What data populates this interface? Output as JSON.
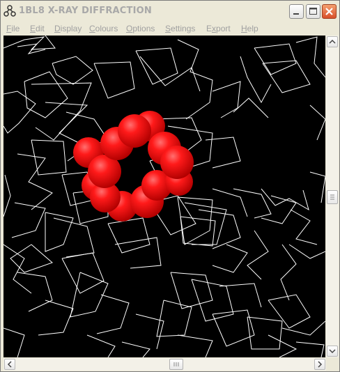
{
  "window": {
    "title": "1BL8 X-RAY DIFFRACTION",
    "app_icon": "molecule-icon",
    "controls": [
      "minimize-icon",
      "maximize-icon",
      "close-icon"
    ]
  },
  "menubar": {
    "items": [
      {
        "underline": "F",
        "rest": "ile"
      },
      {
        "underline": "E",
        "rest": "dit"
      },
      {
        "underline": "D",
        "rest": "isplay"
      },
      {
        "underline": "C",
        "rest": "olours"
      },
      {
        "underline": "O",
        "rest": "ptions"
      },
      {
        "underline": "S",
        "rest": "ettings"
      },
      {
        "underline": "x",
        "prefix": "E",
        "rest": "port"
      },
      {
        "underline": "H",
        "rest": "elp"
      }
    ]
  },
  "viewer": {
    "background": "#000000",
    "wireframe_color": "#ffffff",
    "atom_color": "#ff1a1a"
  }
}
